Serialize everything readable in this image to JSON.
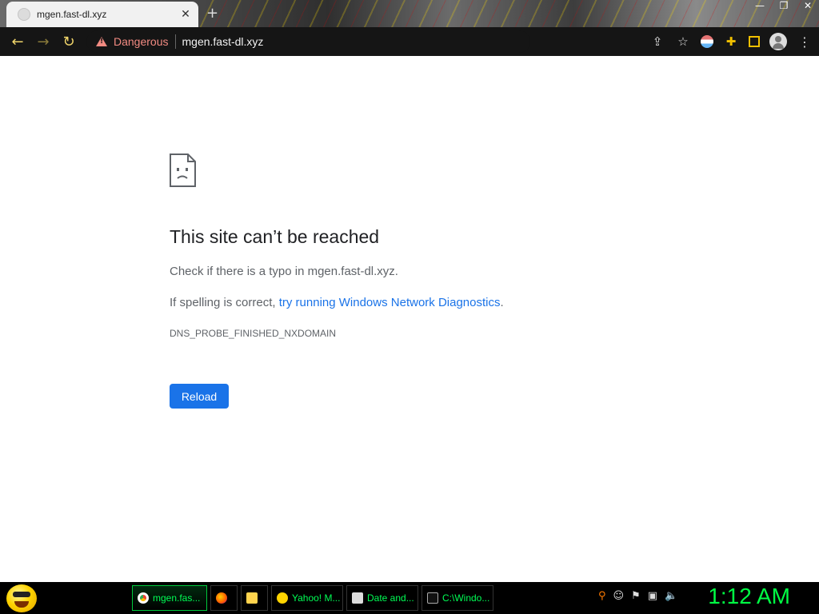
{
  "browser": {
    "tab_title": "mgen.fast-dl.xyz",
    "tab_close": "✕",
    "new_tab": "+",
    "window_buttons": [
      "—",
      "❐",
      "✕"
    ],
    "security_label": "Dangerous",
    "url": "mgen.fast-dl.xyz",
    "toolbar_icons": [
      "share-icon",
      "star-icon",
      "extension-icon",
      "puzzle-icon",
      "side-panel-icon",
      "profile-icon",
      "menu-icon"
    ]
  },
  "page": {
    "heading": "This site can’t be reached",
    "typo_text": "Check if there is a typo in mgen.fast-dl.xyz.",
    "spelling_prefix": "If spelling is correct, ",
    "diagnostics_link": "try running Windows Network Diagnostics",
    "spelling_suffix": ".",
    "error_code": "DNS_PROBE_FINISHED_NXDOMAIN",
    "reload_label": "Reload"
  },
  "taskbar": {
    "items": [
      {
        "label": "mgen.fas...",
        "icon": "chrome-icon"
      },
      {
        "label": "",
        "icon": "firefox-icon"
      },
      {
        "label": "",
        "icon": "folder-icon"
      },
      {
        "label": "Yahoo! M...",
        "icon": "yahoo-icon"
      },
      {
        "label": "Date and...",
        "icon": "date-time-icon"
      },
      {
        "label": "C:\\Windo...",
        "icon": "cmd-icon"
      }
    ],
    "clock": "1:12 AM"
  },
  "colors": {
    "accent": "#1a73e8",
    "danger": "#f28b82",
    "taskbar_text": "#00ff44"
  }
}
